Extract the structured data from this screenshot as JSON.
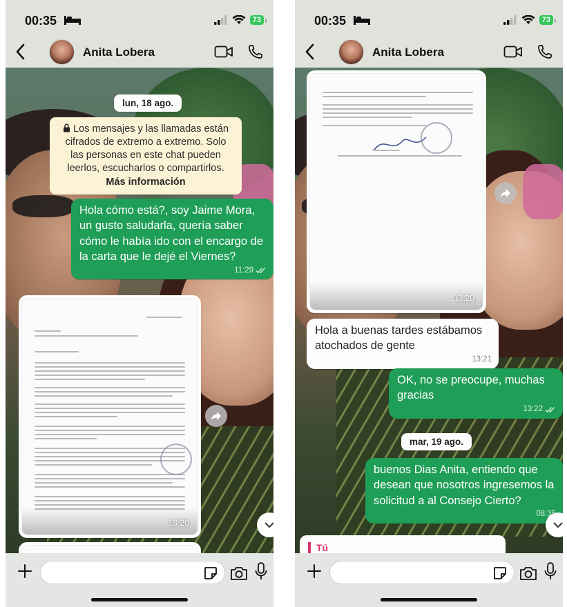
{
  "status_bar": {
    "time": "00:35",
    "battery": "73",
    "icons": [
      "bed-icon",
      "signal-icon",
      "wifi-icon",
      "battery-icon"
    ]
  },
  "header": {
    "contact_name": "Anita Lobera",
    "icons": [
      "back-icon",
      "video-call-icon",
      "voice-call-icon"
    ]
  },
  "composer": {
    "placeholder": "",
    "icons": [
      "plus-icon",
      "sticker-icon",
      "camera-icon",
      "microphone-icon"
    ]
  },
  "left_screen": {
    "date_label": "lun, 18 ago.",
    "encryption_notice": {
      "text": "Los mensajes y las llamadas están cifrados de extremo a extremo. Solo las personas en este chat pueden leerlos, escucharlos o compartirlos.",
      "link": "Más información"
    },
    "msg_outgoing_1": {
      "text": "Hola cómo está?, soy Jaime Mora, un gusto saludarla, quería saber cómo le había ido con el encargo de la carta que le dejé el Viernes?",
      "time": "11:29"
    },
    "image_msg": {
      "time": "13:20"
    }
  },
  "right_screen": {
    "image_msg": {
      "time": "13:20"
    },
    "msg_incoming_1": {
      "text": "Hola a buenas tardes estábamos atochados de gente",
      "time": "13:21"
    },
    "msg_outgoing_2": {
      "text": "OK, no se preocupe, muchas gracias",
      "time": "13:22"
    },
    "date_label": "mar, 19 ago.",
    "msg_outgoing_3": {
      "text": "buenos Dias Anita, entiendo que desean que nosotros ingresemos la solicitud a al Consejo Cierto?",
      "time": "08:35"
    },
    "reply_quote": {
      "author": "Tú"
    }
  },
  "colors": {
    "outgoing_bubble": "#1f9e57",
    "incoming_bubble": "#fdfdfd",
    "system_notice": "#fcf3d6",
    "quote_accent": "#d6336c",
    "battery": "#34c759"
  }
}
